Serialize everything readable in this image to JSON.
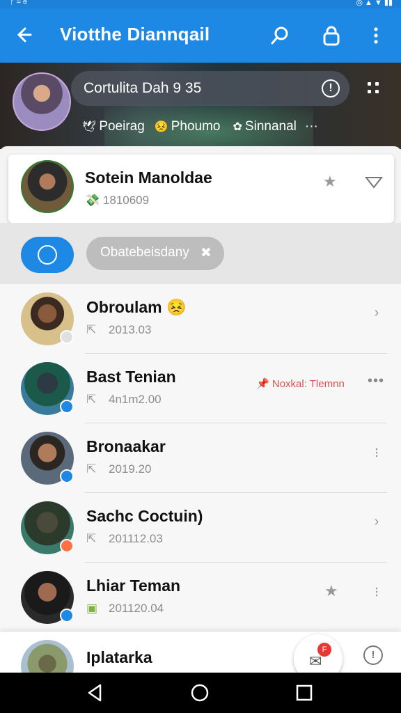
{
  "app_bar": {
    "title": "Viotthe Diannqail",
    "icons": [
      "back-arrow-icon",
      "search-icon",
      "lock-icon",
      "more-vert-icon"
    ]
  },
  "hero": {
    "pill_text": "Cortulita Dah 9 35",
    "chips": [
      {
        "icon": "bird-icon",
        "label": "Poeirag"
      },
      {
        "icon": "emoji-icon",
        "label": "Phoumo"
      },
      {
        "icon": "gear-icon",
        "label": "Sinnanal"
      }
    ],
    "more": "···"
  },
  "pinned": {
    "name": "Sotein Manoldae",
    "meta": "1810609"
  },
  "filter": {
    "chip_label": "Obatebeisdany"
  },
  "contacts": [
    {
      "name": "Obroulam",
      "meta": "2013.03",
      "badge_color": "#9e9e9e"
    },
    {
      "name": "Bast Tenian",
      "meta": "4n1m2.00",
      "tag": "Noxkal: Tlemnn",
      "badge_color": "#1e88e5"
    },
    {
      "name": "Bronaakar",
      "meta": "2019.20",
      "badge_color": "#1e88e5"
    },
    {
      "name": "Sachc Coctuin)",
      "meta": "201112.03",
      "badge_color": "#ff7043"
    },
    {
      "name": "Lhiar Teman",
      "meta": "201120.04",
      "badge_color": "#1e88e5"
    }
  ],
  "bottom": {
    "name": "Iplatarka",
    "fab_badge": "F"
  },
  "colors": {
    "primary": "#1e88e5",
    "accent_red": "#d9534f"
  }
}
